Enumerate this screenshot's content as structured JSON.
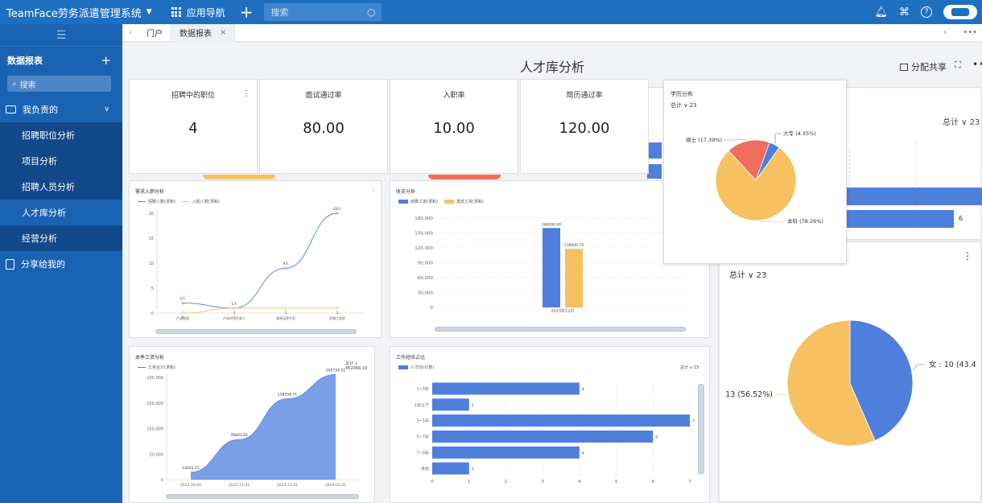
{
  "app": {
    "title": "TeamFace劳务派遣管理系统",
    "nav_label": "应用导航",
    "search_placeholder": "搜索"
  },
  "sidebar": {
    "section_title": "数据报表",
    "search_placeholder": "搜索",
    "group_label": "我负责的",
    "items": [
      {
        "label": "招聘职位分析"
      },
      {
        "label": "项目分析"
      },
      {
        "label": "招聘人员分析"
      },
      {
        "label": "人才库分析",
        "active": true
      },
      {
        "label": "经营分析"
      }
    ],
    "share_label": "分享给我的"
  },
  "tabs": [
    {
      "label": "门户"
    },
    {
      "label": "数据报表",
      "closable": true
    }
  ],
  "page": {
    "title": "人才库分析",
    "share_label": "分配共享"
  },
  "kpis": [
    {
      "label": "招聘中的职位",
      "value": "4"
    },
    {
      "label": "面试通过率",
      "value": "80.00"
    },
    {
      "label": "入职率",
      "value": "10.00"
    },
    {
      "label": "简历通过率",
      "value": "120.00"
    }
  ],
  "colors": {
    "blue": "#4e7fdd",
    "orange": "#f7c060",
    "red": "#ee6d5d",
    "topbar": "#1f6fc0",
    "sidebar": "#1a63b3"
  },
  "chart_data": [
    {
      "type": "line",
      "title": "需求入职分析",
      "categories": [
        "产品经理",
        "产研学院负责人",
        "基建运营专家",
        "前端工程师"
      ],
      "series": [
        {
          "name": "招聘人数(求和)",
          "values": [
            2,
            1,
            9,
            20
          ],
          "labels": [
            "2人",
            "1人",
            "9人",
            "20人"
          ]
        },
        {
          "name": "入职人数(求和)",
          "values": [
            0,
            1,
            1,
            1
          ],
          "labels": [
            "0",
            "1",
            "1",
            "1"
          ]
        }
      ],
      "y_ticks": [
        "0",
        "5",
        "10",
        "15",
        "20"
      ],
      "ylim": [
        0,
        20
      ]
    },
    {
      "type": "bar",
      "title": "收支分析",
      "categories": [
        "2023年11月"
      ],
      "series": [
        {
          "name": "结算工资(求和)",
          "values": [
            160000
          ],
          "label": "160000.00"
        },
        {
          "name": "发放工资(求和)",
          "values": [
            118000
          ],
          "label": "118000.73"
        }
      ],
      "y_ticks": [
        "0",
        "30,000",
        "60,000",
        "90,000",
        "120,000",
        "150,000",
        "180,000"
      ],
      "ylim": [
        0,
        180000
      ]
    },
    {
      "type": "area",
      "title": "本季工资分析",
      "total": "总计 ∨ 452066.19",
      "categories": [
        "2023-10-01",
        "2023-11-01",
        "2023-12-01",
        "2024-01-01"
      ],
      "series": [
        {
          "name": "工资合计(求和)",
          "values": [
            14501.15,
            78491.83,
            158258.71,
            205724.51
          ],
          "labels": [
            "14501.15",
            "78491.83",
            "158258.71",
            "205724.51"
          ]
        }
      ],
      "y_ticks": [
        "0",
        "50,000",
        "100,000",
        "150,000",
        "200,000"
      ],
      "ylim": [
        0,
        200000
      ]
    },
    {
      "type": "bar",
      "orientation": "horizontal",
      "title": "工作经验占比",
      "total": "总计 ∨ 23",
      "categories": [
        "1~3年",
        "1年以下",
        "3~5年",
        "5~7年",
        "7~9年",
        "未知"
      ],
      "series": [
        {
          "name": "人才ID(计数)",
          "values": [
            4,
            1,
            7,
            6,
            4,
            1
          ]
        }
      ],
      "x_ticks": [
        "0",
        "1",
        "2",
        "3",
        "4",
        "5",
        "6",
        "7"
      ],
      "xlim": [
        0,
        7
      ]
    },
    {
      "type": "pie",
      "title": "学历分布",
      "total": "总计 ∨ 23",
      "slices": [
        {
          "name": "大专",
          "label": "大专  (4.35%)",
          "value": 4.35
        },
        {
          "name": "本科",
          "label": "本科  (78.26%)",
          "value": 78.26
        },
        {
          "name": "硕士",
          "label": "硕士  (17.39%)",
          "value": 17.39
        }
      ]
    },
    {
      "type": "pie",
      "total": "总计 ∨ 23",
      "slices": [
        {
          "name": "女",
          "label": "女 : 10 (43.4",
          "value": 43.48
        },
        {
          "label": "13 (56.52%)",
          "value": 56.52
        }
      ]
    }
  ],
  "background": {
    "total_label": "总计 ∨ 23",
    "bar_value": "6"
  }
}
